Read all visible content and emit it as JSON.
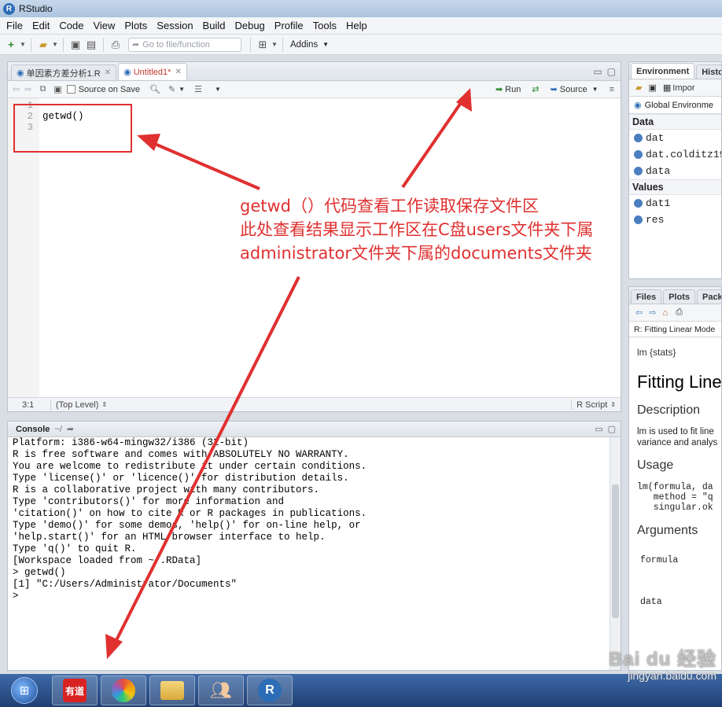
{
  "window": {
    "title": "RStudio"
  },
  "menu": [
    "File",
    "Edit",
    "Code",
    "View",
    "Plots",
    "Session",
    "Build",
    "Debug",
    "Profile",
    "Tools",
    "Help"
  ],
  "toolbar": {
    "goto_placeholder": "Go to file/function",
    "addins": "Addins"
  },
  "editor": {
    "tabs": [
      {
        "label": "单因素方差分析1.R"
      },
      {
        "label": "Untitled1*"
      }
    ],
    "source_on_save": "Source on Save",
    "run": "Run",
    "source": "Source",
    "line_numbers": [
      "1",
      "2",
      "3"
    ],
    "code_lines": [
      "",
      "getwd()",
      ""
    ],
    "cursor_pos": "3:1",
    "scope": "(Top Level)",
    "file_type": "R Script"
  },
  "console": {
    "title": "Console",
    "path": "~/",
    "lines": [
      "Platform: i386-w64-mingw32/i386 (32-bit)",
      "",
      "R is free software and comes with ABSOLUTELY NO WARRANTY.",
      "You are welcome to redistribute it under certain conditions.",
      "Type 'license()' or 'licence()' for distribution details.",
      "",
      "R is a collaborative project with many contributors.",
      "Type 'contributors()' for more information and",
      "'citation()' on how to cite R or R packages in publications.",
      "",
      "Type 'demo()' for some demos, 'help()' for on-line help, or",
      "'help.start()' for an HTML browser interface to help.",
      "Type 'q()' to quit R.",
      "",
      "[Workspace loaded from ~/.RData]",
      ""
    ],
    "cmd": "> getwd()",
    "result": "[1] \"C:/Users/Administrator/Documents\"",
    "prompt": ">"
  },
  "environment": {
    "tabs": [
      "Environment",
      "Histo"
    ],
    "import": "Impor",
    "scope": "Global Environme",
    "data_header": "Data",
    "data_items": [
      "dat",
      "dat.colditz19",
      "data"
    ],
    "values_header": "Values",
    "value_items": [
      "dat1",
      "res"
    ]
  },
  "files": {
    "tabs": [
      "Files",
      "Plots",
      "Pack"
    ],
    "help_topic": "R: Fitting Linear Mode",
    "pkg": "lm {stats}",
    "title": "Fitting Line",
    "description_h": "Description",
    "description_l1": "lm is used to fit line",
    "description_l2": "variance and analys",
    "usage_h": "Usage",
    "usage_l1": "lm(formula, da",
    "usage_l2": "   method = \"q",
    "usage_l3": "   singular.ok",
    "arguments_h": "Arguments",
    "arg1": "formula",
    "arg2": "data"
  },
  "annotation": {
    "line1": "getwd（）代码查看工作读取保存文件区",
    "line2": "此处查看结果显示工作区在C盘users文件夹下属",
    "line3": "administrator文件夹下属的documents文件夹"
  },
  "taskbar": {
    "youdao": "有道"
  },
  "watermark": {
    "brand": "Bai du 经验",
    "url": "jingyan.baidu.com"
  }
}
